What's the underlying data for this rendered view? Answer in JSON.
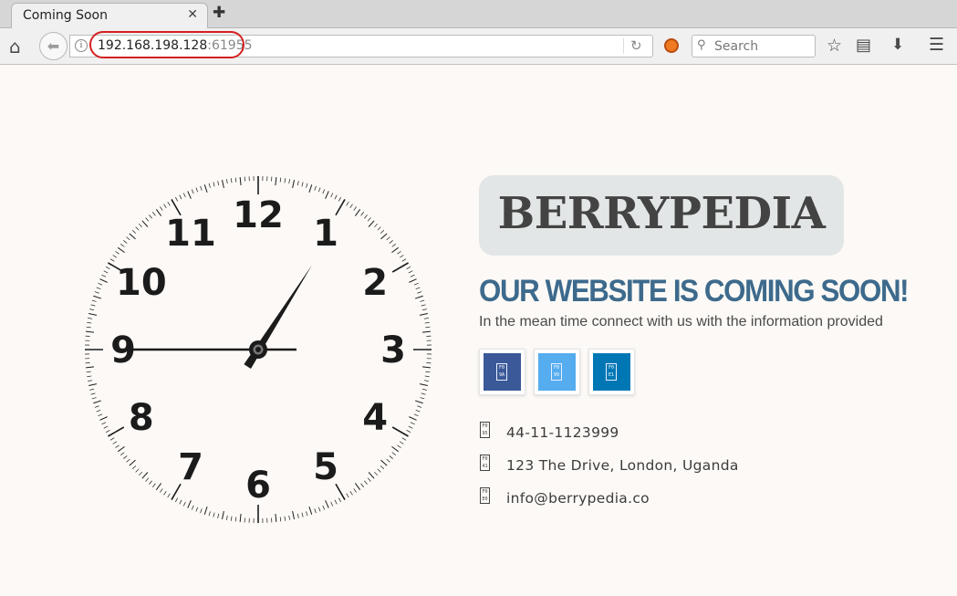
{
  "browser": {
    "tab_title": "Coming Soon",
    "tab_close": "✕",
    "new_tab": "✚",
    "url_host": "192.168.198.128",
    "url_port": ":61955",
    "search_placeholder": "Search",
    "icons": {
      "home": "⌂",
      "back": "⬅",
      "reload": "↻",
      "search": "🔍",
      "bookmark": "☆",
      "reading_list": "▤",
      "download": "⬇",
      "menu": "☰"
    }
  },
  "clock": {
    "numerals": [
      "12",
      "1",
      "2",
      "3",
      "4",
      "5",
      "6",
      "7",
      "8",
      "9",
      "10",
      "11"
    ],
    "time": {
      "hour": 1,
      "minute": 5,
      "second": 45
    },
    "color": "#1b1b1b"
  },
  "page": {
    "logo": "BERRYPEDIA",
    "headline": "OUR WEBSITE IS COMING SOON!",
    "subline": "In the mean time connect with us with the information provided",
    "social": [
      {
        "name": "facebook",
        "color": "#3b5998",
        "glyph": "F0 9A"
      },
      {
        "name": "twitter",
        "color": "#55acee",
        "glyph": "F0 99"
      },
      {
        "name": "linkedin",
        "color": "#0077b5",
        "glyph": "F0 E1"
      }
    ],
    "contacts": [
      {
        "icon": "phone",
        "glyph": "F0 95",
        "text": "44-11-1123999"
      },
      {
        "icon": "map-marker",
        "glyph": "F0 41",
        "text": "123 The Drive, London, Uganda"
      },
      {
        "icon": "envelope",
        "glyph": "F0 E0",
        "text": "info@berrypedia.co"
      }
    ],
    "accent_color": "#3d6a8c"
  }
}
